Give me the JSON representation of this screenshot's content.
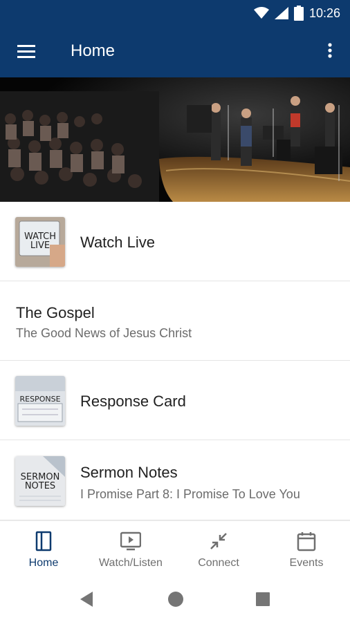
{
  "status_bar": {
    "time": "10:26",
    "icons": [
      "wifi-icon",
      "signal-icon",
      "battery-icon"
    ]
  },
  "app_bar": {
    "title": "Home",
    "menu_icon": "hamburger-menu-icon",
    "overflow_icon": "more-vertical-icon",
    "color": "#0d3a6e"
  },
  "hero": {
    "image": "band-performing-on-stage-photo"
  },
  "list": {
    "items": [
      {
        "title": "Watch Live",
        "subtitle": "",
        "thumb_text": "WATCH LIVE"
      },
      {
        "title": "The Gospel",
        "subtitle": "The Good News of Jesus Christ"
      },
      {
        "title": "Response Card",
        "subtitle": "",
        "thumb_text": "RESPONSE"
      },
      {
        "title": "Sermon Notes",
        "subtitle": "I Promise Part 8: I Promise To Love You",
        "thumb_text": "SERMON NOTES"
      }
    ]
  },
  "bottom_nav": {
    "items": [
      {
        "label": "Home",
        "icon": "home-panel-icon",
        "active": true
      },
      {
        "label": "Watch/Listen",
        "icon": "tv-play-icon",
        "active": false
      },
      {
        "label": "Connect",
        "icon": "connect-arrows-icon",
        "active": false
      },
      {
        "label": "Events",
        "icon": "calendar-icon",
        "active": false
      }
    ],
    "active_color": "#0d3a6e",
    "inactive_color": "#6f6f6f"
  },
  "system_nav": {
    "buttons": [
      "back-icon",
      "home-circle-icon",
      "recents-square-icon"
    ]
  }
}
